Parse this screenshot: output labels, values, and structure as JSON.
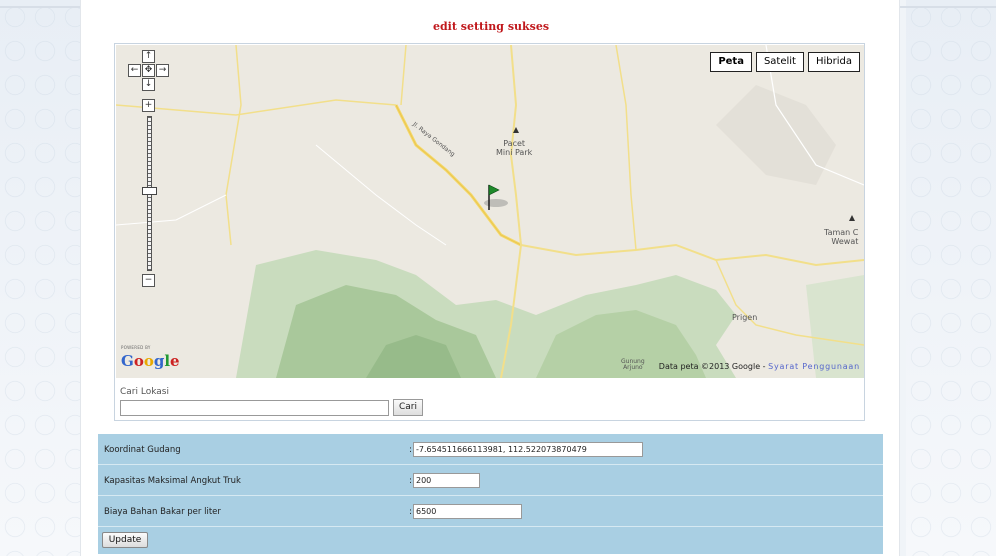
{
  "message": "edit setting sukses",
  "map": {
    "types": [
      {
        "label": "Peta",
        "active": true
      },
      {
        "label": "Satelit",
        "active": false
      },
      {
        "label": "Hibrida",
        "active": false
      }
    ],
    "places": {
      "park": "Pacet\nMini Park",
      "taman": "Taman C\nWewat",
      "prigen": "Prigen",
      "gunung": "Gunung\nArjuno",
      "road": "Jl. Raya Gondang"
    },
    "logo_powered": "POWERED BY",
    "logo_word": "Google",
    "copyright": "Data peta ©2013 Google - ",
    "terms": "Syarat Penggunaan",
    "nav_icons": [
      "pan-up-icon",
      "pan-left-icon",
      "pan-center-icon",
      "pan-right-icon",
      "pan-down-icon",
      "zoom-in-icon",
      "zoom-out-icon"
    ]
  },
  "search": {
    "label": "Cari Lokasi",
    "value": "",
    "button": "Cari"
  },
  "settings": {
    "rows": [
      {
        "label": "Koordinat Gudang",
        "value": "-7.654511666113981, 112.522073870479"
      },
      {
        "label": "Kapasitas Maksimal Angkut Truk",
        "value": "200"
      },
      {
        "label": "Biaya Bahan Bakar per liter",
        "value": "6500"
      }
    ],
    "update_button": "Update"
  },
  "colors": {
    "message": "#c0181c",
    "settings_bg": "#a9cfe3",
    "marker": "#1f8a2a"
  }
}
